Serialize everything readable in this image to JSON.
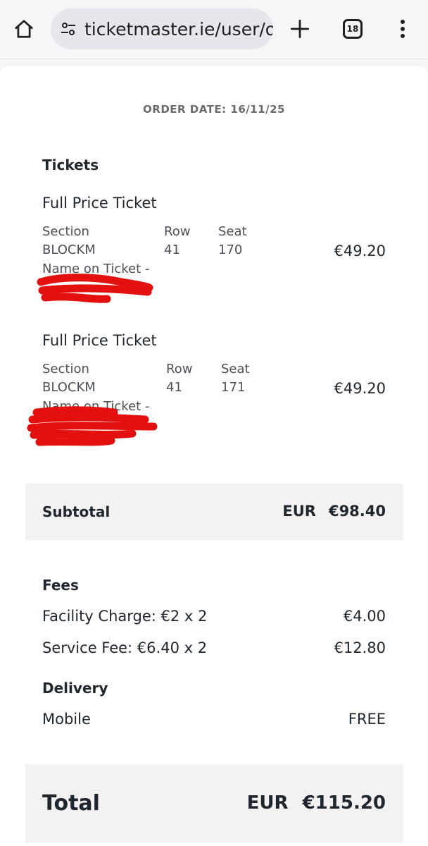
{
  "browser": {
    "url": "ticketmaster.ie/user/o",
    "tab_count": "18",
    "icons": [
      "home-icon",
      "site-settings-icon",
      "plus-icon",
      "tabs-icon",
      "more-vert-icon"
    ]
  },
  "order": {
    "date_label": "ORDER DATE: 16/11/25",
    "tickets_title": "Tickets",
    "tickets": [
      {
        "name": "Full Price Ticket",
        "section_label": "Section",
        "section": "BLOCKM",
        "row_label": "Row",
        "row": "41",
        "seat_label": "Seat",
        "seat": "170",
        "name_on_ticket_label": "Name on Ticket -",
        "price": "€49.20"
      },
      {
        "name": "Full Price Ticket",
        "section_label": "Section",
        "section": "BLOCKM",
        "row_label": "Row",
        "row": "41",
        "seat_label": "Seat",
        "seat": "171",
        "name_on_ticket_label": "Name on Ticket -",
        "price": "€49.20"
      }
    ],
    "subtotal": {
      "label": "Subtotal",
      "currency": "EUR",
      "amount": "€98.40"
    },
    "fees_title": "Fees",
    "fees": [
      {
        "label": "Facility Charge: €2 x 2",
        "amount": "€4.00"
      },
      {
        "label": "Service Fee: €6.40 x 2",
        "amount": "€12.80"
      }
    ],
    "delivery_title": "Delivery",
    "delivery": {
      "label": "Mobile",
      "amount": "FREE"
    },
    "total": {
      "label": "Total",
      "currency": "EUR",
      "amount": "€115.20"
    }
  },
  "colors": {
    "redaction": "#e3100f",
    "panel": "#f2f2f2",
    "text": "#1f262d",
    "muted": "#4c5157"
  }
}
